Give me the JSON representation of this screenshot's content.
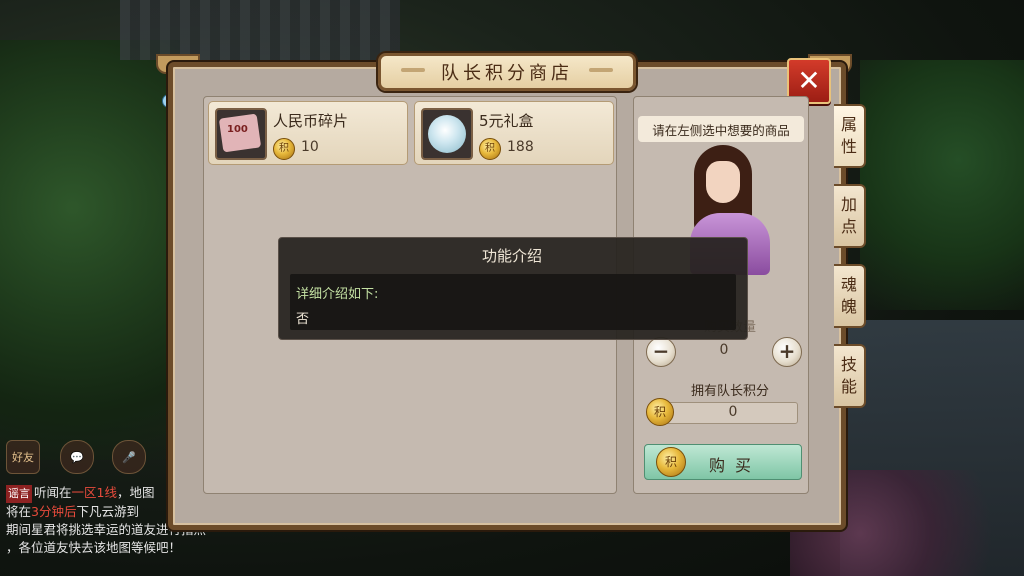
{
  "shop": {
    "title": "队长积分商店",
    "close_symbol": "✕",
    "items": [
      {
        "name": "人民币碎片",
        "price": "10",
        "icon": "rmb-fragment-icon",
        "icon_text": "100"
      },
      {
        "name": "5元礼盒",
        "price": "188",
        "icon": "gift-box-icon"
      }
    ],
    "detail": {
      "hint": "请在左侧选中想要的商品",
      "quantity_label": "购买数量",
      "quantity": "0",
      "minus": "−",
      "plus": "+",
      "points_label": "拥有队长积分",
      "points": "0",
      "buy_label": "购买",
      "coin_glyph": "积"
    },
    "side_tabs": [
      "属性",
      "加点",
      "魂魄",
      "技能"
    ]
  },
  "intro_popup": {
    "title": "功能介绍",
    "label": "详细介绍如下:",
    "value": "否"
  },
  "chat": {
    "icon_labels": [
      "好友"
    ],
    "lines": [
      {
        "tag": "谣言",
        "text_a": "听闻在",
        "highlight_a": "一区1线",
        "text_b": "，地图"
      },
      {
        "text_a": "将在",
        "highlight_a": "3分钟后",
        "text_b": "下凡云游到"
      },
      {
        "text_a": "期间星君将挑选幸运的道友进行指点"
      },
      {
        "text_a": "，各位道友快去该地图等候吧！"
      }
    ]
  }
}
